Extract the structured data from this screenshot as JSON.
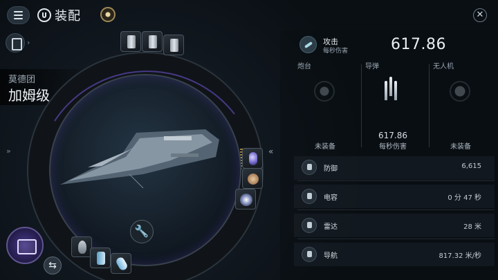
{
  "header": {
    "menu_icon": "hamburger-icon",
    "title_icon": "ship-helmet-icon",
    "title": "装配",
    "skill_icon": "skill-target-icon",
    "close_icon": "close-x-icon"
  },
  "ship": {
    "faction": "莫德团",
    "name": "加姆级",
    "name_arrow": "»"
  },
  "fitting": {
    "edge_left": "»",
    "edge_right": "«",
    "wrench_icon": "wrench-icon",
    "hangar_icon": "hangar-icon",
    "swap_icon": "swap-icon",
    "slots": {
      "high": [
        "high-slot-module",
        "high-slot-module",
        "high-slot-module"
      ],
      "medium": [
        "shield-module",
        "armor-module",
        "energy-module"
      ],
      "right": [
        "capacitor-module",
        "booster-module",
        "lightning-module"
      ]
    }
  },
  "stats": {
    "attack": {
      "label": "攻击",
      "sublabel": "每秒伤害",
      "value": "617.86"
    },
    "weapons": [
      {
        "label": "炮台",
        "status": "未装备",
        "icon": "turret-icon"
      },
      {
        "label": "导弹",
        "value": "617.86",
        "status": "每秒伤害",
        "icon": "missile-icon"
      },
      {
        "label": "无人机",
        "status": "未装备",
        "icon": "drone-icon"
      }
    ],
    "rows": [
      {
        "label": "防御",
        "value": "6,615",
        "icon": "shield-icon"
      },
      {
        "label": "电容",
        "value": "0 分 47 秒",
        "icon": "capacitor-icon"
      },
      {
        "label": "雷达",
        "value": "28 米",
        "icon": "radar-icon"
      },
      {
        "label": "导航",
        "value": "817.32 米/秒",
        "icon": "navigation-icon"
      }
    ]
  }
}
